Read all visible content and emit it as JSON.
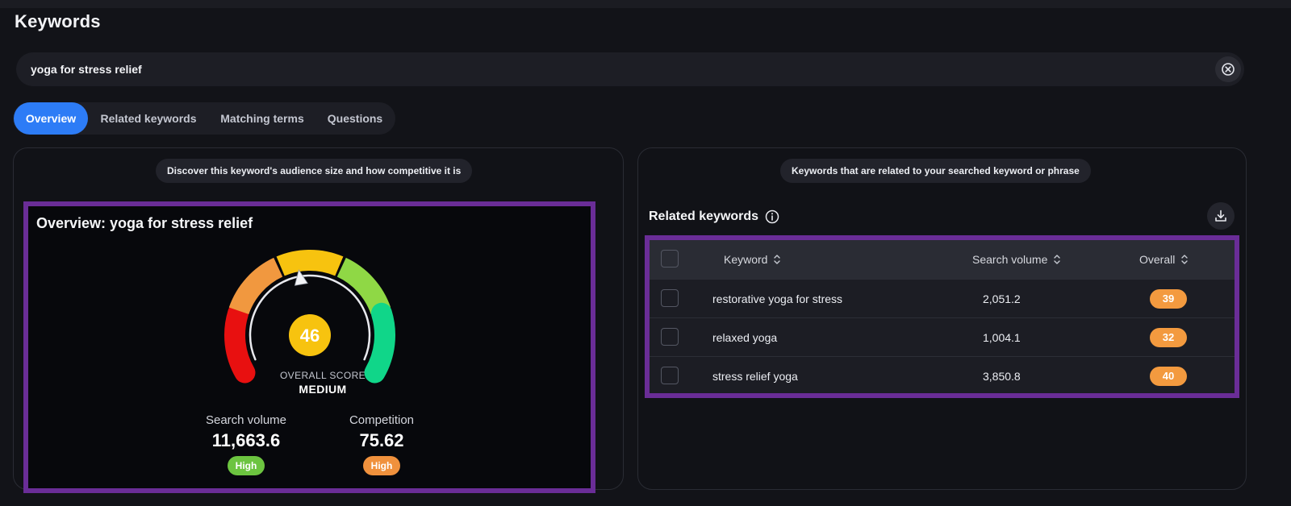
{
  "page": {
    "title": "Keywords"
  },
  "search": {
    "value": "yoga for stress relief"
  },
  "tabs": [
    {
      "label": "Overview",
      "active": true
    },
    {
      "label": "Related keywords",
      "active": false
    },
    {
      "label": "Matching terms",
      "active": false
    },
    {
      "label": "Questions",
      "active": false
    }
  ],
  "overview_panel": {
    "hint": "Discover this keyword's audience size and how competitive it is",
    "title": "Overview: yoga for stress relief",
    "score": {
      "value": "46",
      "fraction": 0.46,
      "label": "OVERALL SCORE",
      "level": "MEDIUM"
    },
    "metrics": {
      "search_volume": {
        "label": "Search volume",
        "value": "11,663.6",
        "badge": "High",
        "badge_color": "#6cc440"
      },
      "competition": {
        "label": "Competition",
        "value": "75.62",
        "badge": "High",
        "badge_color": "#f0913d"
      }
    },
    "gauge_colors": [
      "#e81010",
      "#f1983f",
      "#f7c30f",
      "#8fd845",
      "#10d689"
    ]
  },
  "related_panel": {
    "hint": "Keywords that are related to your searched keyword or phrase",
    "title": "Related keywords",
    "columns": {
      "keyword": "Keyword",
      "search_volume": "Search volume",
      "overall": "Overall"
    },
    "rows": [
      {
        "keyword": "restorative yoga for stress",
        "search_volume": "2,051.2",
        "overall": "39"
      },
      {
        "keyword": "relaxed yoga",
        "search_volume": "1,004.1",
        "overall": "32"
      },
      {
        "keyword": "stress relief yoga",
        "search_volume": "3,850.8",
        "overall": "40"
      }
    ],
    "chip_color": "#f39a3f"
  },
  "colors": {
    "accent": "#2d7cf6",
    "highlight_border": "#6a2d97",
    "score_circle": "#f7c30f"
  }
}
